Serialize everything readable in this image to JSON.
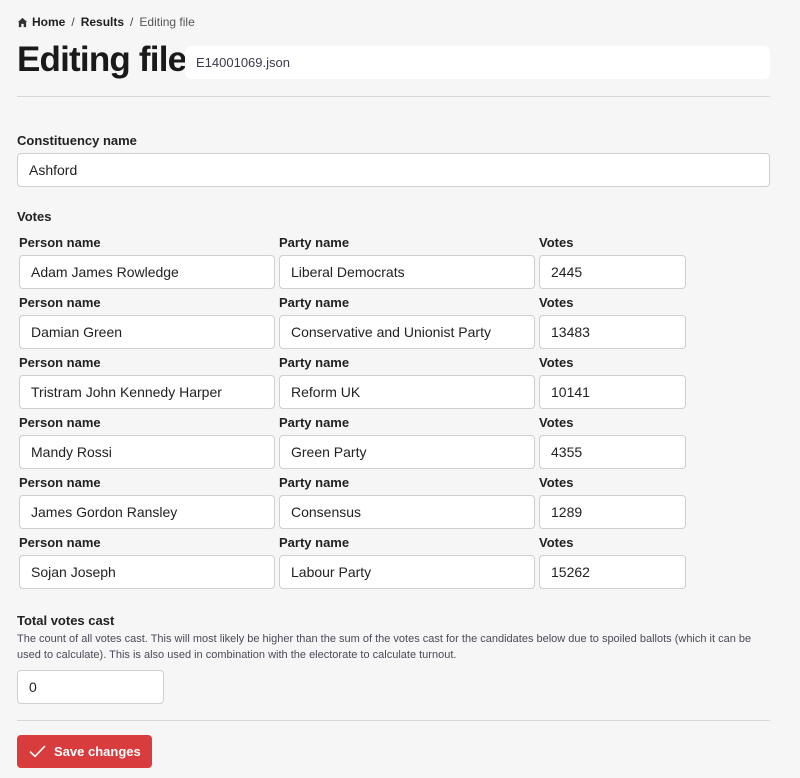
{
  "breadcrumb": {
    "home": "Home",
    "separator": "/",
    "results": "Results",
    "current": "Editing file"
  },
  "header": {
    "title": "Editing file",
    "filename": "E14001069.json"
  },
  "constituency": {
    "label": "Constituency name",
    "value": "Ashford"
  },
  "votes": {
    "label": "Votes",
    "column_labels": {
      "person": "Person name",
      "party": "Party name",
      "votes": "Votes"
    },
    "rows": [
      {
        "person": "Adam James Rowledge",
        "party": "Liberal Democrats",
        "votes": "2445"
      },
      {
        "person": "Damian Green",
        "party": "Conservative and Unionist Party",
        "votes": "13483"
      },
      {
        "person": "Tristram John Kennedy Harper",
        "party": "Reform UK",
        "votes": "10141"
      },
      {
        "person": "Mandy Rossi",
        "party": "Green Party",
        "votes": "4355"
      },
      {
        "person": "James Gordon Ransley",
        "party": "Consensus",
        "votes": "1289"
      },
      {
        "person": "Sojan Joseph",
        "party": "Labour Party",
        "votes": "15262"
      }
    ]
  },
  "total": {
    "label": "Total votes cast",
    "help": "The count of all votes cast. This will most likely be higher than the sum of the votes cast for the candidates below due to spoiled ballots (which it can be used to calculate). This is also used in combination with the electorate to calculate turnout.",
    "value": "0"
  },
  "actions": {
    "save_label": "Save changes"
  },
  "colors": {
    "accent": "#d93c3c",
    "background": "#f6f6f6"
  },
  "icons": {
    "home": "home-icon",
    "save": "check-icon"
  }
}
